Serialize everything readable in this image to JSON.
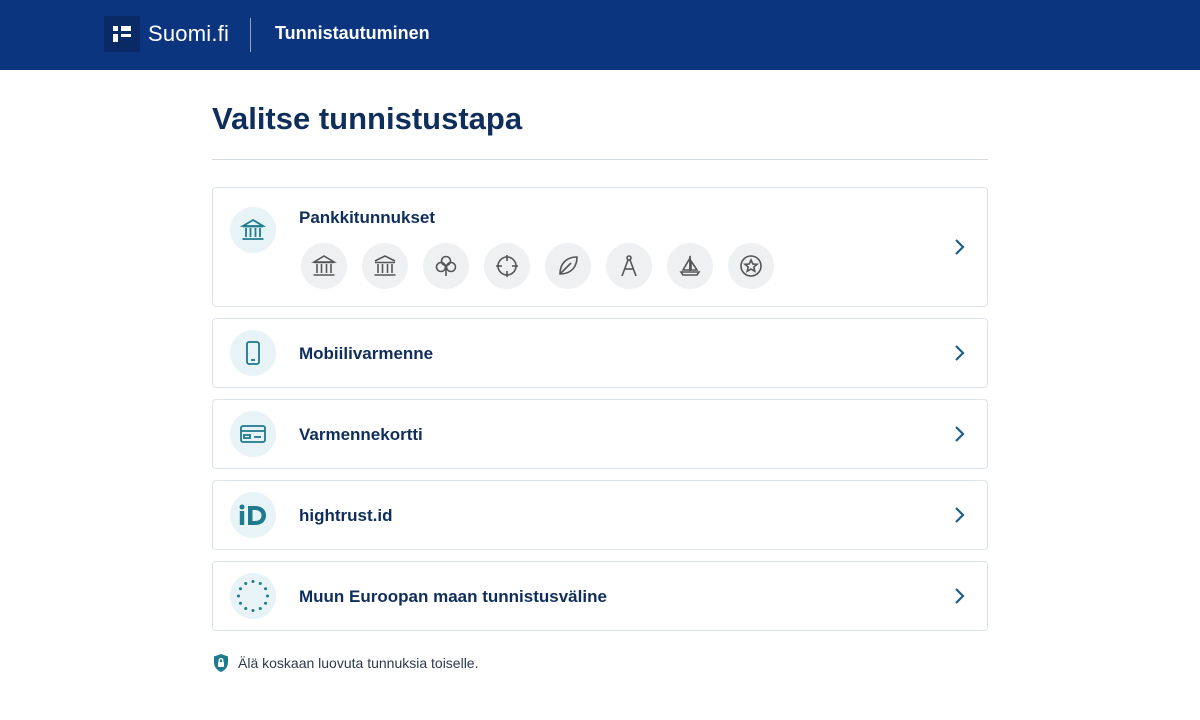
{
  "header": {
    "logo_text": "Suomi.fi",
    "service_name": "Tunnistautuminen"
  },
  "main": {
    "title": "Valitse tunnistustapa",
    "methods": [
      {
        "label": "Pankkitunnukset",
        "icon": "bank-icon"
      },
      {
        "label": "Mobiilivarmenne",
        "icon": "mobile-phone-icon"
      },
      {
        "label": "Varmennekortti",
        "icon": "id-card-icon"
      },
      {
        "label": "hightrust.id",
        "icon": "hightrust-id-icon"
      },
      {
        "label": "Muun Euroopan maan tunnistusväline",
        "icon": "eu-stars-icon"
      }
    ],
    "banks": [
      {
        "icon": "bank-building-icon"
      },
      {
        "icon": "bank-building-icon"
      },
      {
        "icon": "clover-icon"
      },
      {
        "icon": "crosshair-icon"
      },
      {
        "icon": "leaf-icon"
      },
      {
        "icon": "compass-icon"
      },
      {
        "icon": "sailboat-icon"
      },
      {
        "icon": "star-badge-icon"
      }
    ]
  },
  "footer": {
    "notice": "Älä koskaan luovuta tunnuksia toiselle."
  },
  "colors": {
    "header_bg": "#0c3580",
    "title": "#0f2e5c",
    "accent": "#1e7a8c",
    "icon_bg": "#e7f3f6"
  }
}
